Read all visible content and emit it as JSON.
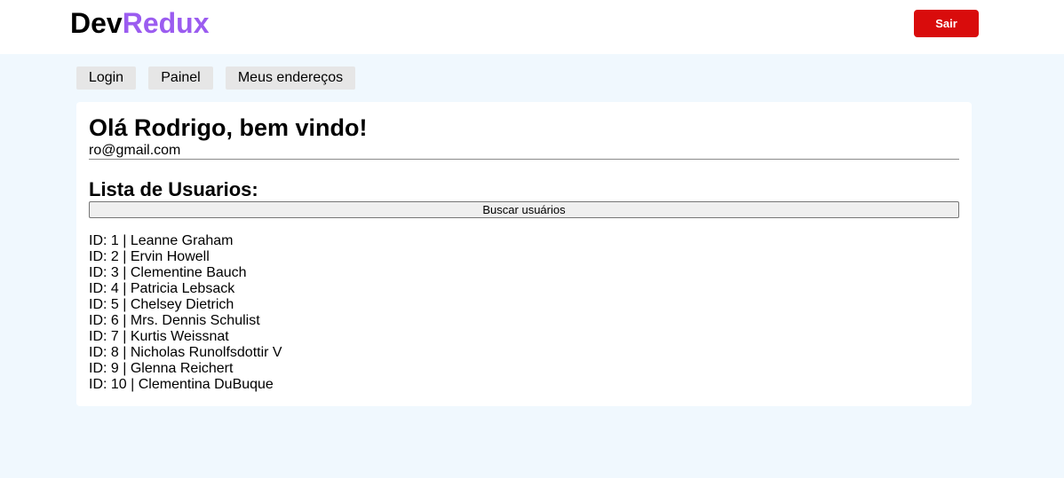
{
  "header": {
    "logo_part1": "Dev",
    "logo_part2": "Redux",
    "logout_label": "Sair"
  },
  "nav": {
    "items": [
      {
        "label": "Login"
      },
      {
        "label": "Painel"
      },
      {
        "label": "Meus endereços"
      }
    ]
  },
  "main": {
    "greeting": "Olá Rodrigo, bem vindo!",
    "email": "ro@gmail.com",
    "list_title": "Lista de Usuarios:",
    "fetch_button_label": "Buscar usuários",
    "users": [
      "ID: 1 | Leanne Graham",
      "ID: 2 | Ervin Howell",
      "ID: 3 | Clementine Bauch",
      "ID: 4 | Patricia Lebsack",
      "ID: 5 | Chelsey Dietrich",
      "ID: 6 | Mrs. Dennis Schulist",
      "ID: 7 | Kurtis Weissnat",
      "ID: 8 | Nicholas Runolfsdottir V",
      "ID: 9 | Glenna Reichert",
      "ID: 10 | Clementina DuBuque"
    ]
  },
  "colors": {
    "background": "#f0f8fe",
    "logo_accent": "#9b5cf0",
    "logout_button": "#d90c0c"
  }
}
